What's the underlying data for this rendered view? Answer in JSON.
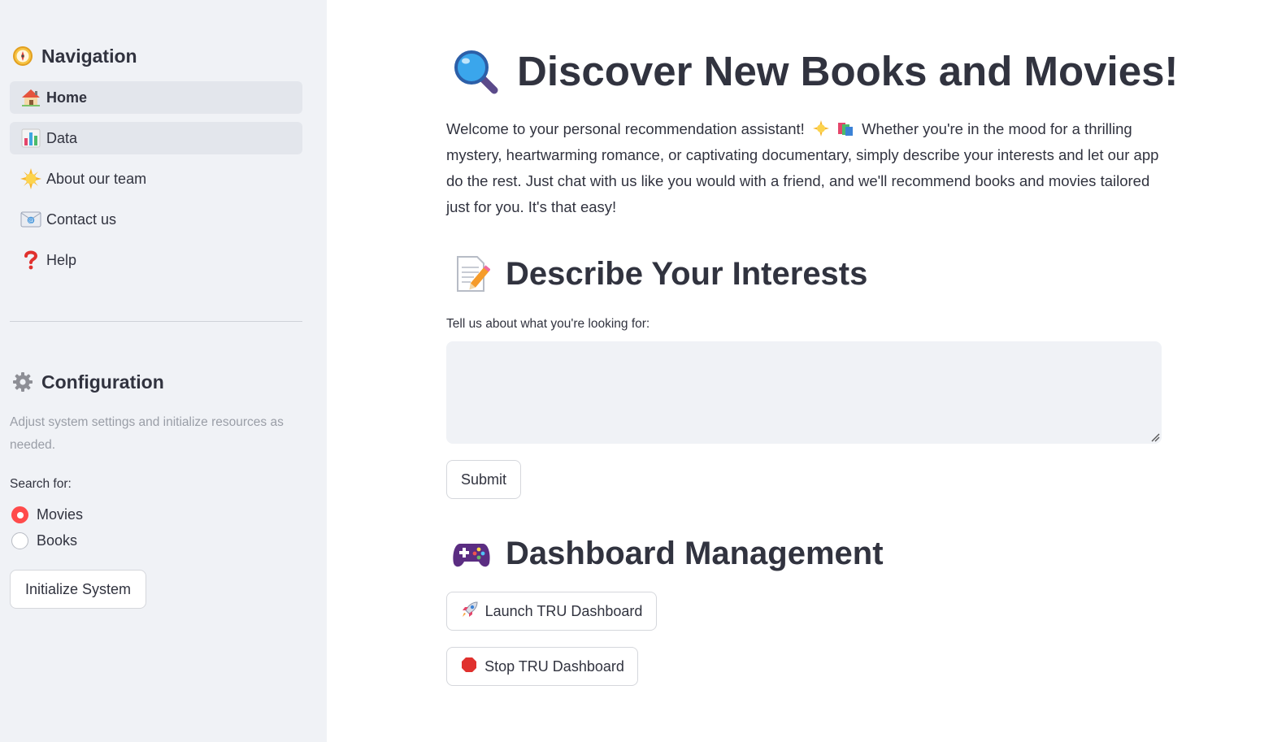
{
  "sidebar": {
    "navigation_title": "Navigation",
    "nav_items": [
      {
        "label": "Home",
        "icon": "house-icon",
        "active": true
      },
      {
        "label": "Data",
        "icon": "bar-chart-icon"
      },
      {
        "label": "About our team",
        "icon": "sun-icon"
      },
      {
        "label": "Contact us",
        "icon": "envelope-icon"
      },
      {
        "label": "Help",
        "icon": "question-mark-icon"
      }
    ],
    "configuration_title": "Configuration",
    "configuration_caption": "Adjust system settings and initialize resources as needed.",
    "search_label": "Search for:",
    "search_options": [
      "Movies",
      "Books"
    ],
    "search_selected": "Movies",
    "initialize_button": "Initialize System"
  },
  "main": {
    "title": "Discover New Books and Movies!",
    "intro_before_emoji": "Welcome to your personal recommendation assistant!",
    "intro_after_emoji": "Whether you're in the mood for a thrilling mystery, heartwarming romance, or captivating documentary, simply describe your interests and let our app do the rest. Just chat with us like you would with a friend, and we'll recommend books and movies tailored just for you. It's that easy!",
    "interests_heading": "Describe Your Interests",
    "interests_label": "Tell us about what you're looking for:",
    "interests_value": "",
    "submit_button": "Submit",
    "dashboard_heading": "Dashboard Management",
    "launch_button": "Launch TRU Dashboard",
    "stop_button": "Stop TRU Dashboard"
  },
  "colors": {
    "sidebar_bg": "#f0f2f6",
    "text": "#31333f",
    "radio_accent": "#ff4b4b",
    "caption": "#9a9ea7"
  }
}
